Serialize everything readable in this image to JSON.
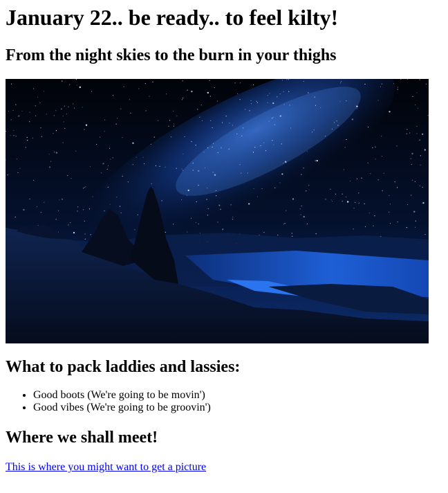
{
  "page": {
    "title": "January 22.. be ready.. to feel kilty!",
    "subtitle": "From the night skies to the burn in your thighs"
  },
  "hero_image": {
    "description_icon": "night-sky-landscape-image"
  },
  "packing": {
    "heading": "What to pack laddies and lassies:",
    "items": [
      "Good boots (We're going to be movin')",
      "Good vibes (We're going to be groovin')"
    ]
  },
  "meeting": {
    "heading": "Where we shall meet!",
    "link_text": "This is where you might want to get a picture"
  },
  "colors": {
    "link": "#0000ee",
    "sky_deep": "#010510",
    "sky_glow": "#1a4db8",
    "water": "#1e5fd6"
  }
}
